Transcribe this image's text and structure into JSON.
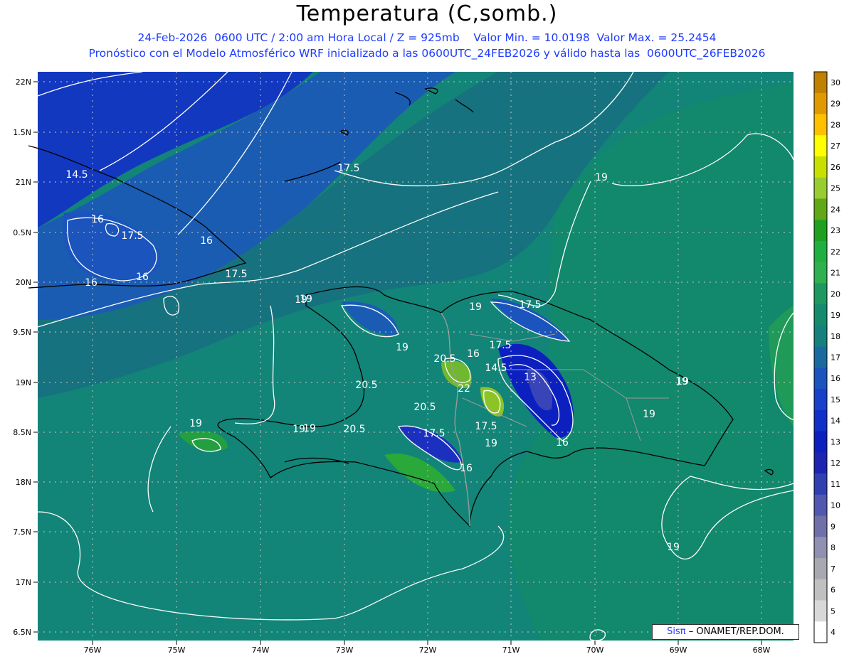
{
  "header": {
    "title": "Temperatura (C,somb.)",
    "subtitle1": "24-Feb-2026  0600 UTC / 2:00 am Hora Local / Z = 925mb    Valor Min. = 10.0198  Valor Max. = 25.2454",
    "subtitle2": "Pronóstico con el Modelo Atmosférico WRF inicializado a las 0600UTC_24FEB2026 y válido hasta las  0600UTC_26FEB2026"
  },
  "map": {
    "lat_labels": [
      "22N",
      "1.5N",
      "21N",
      "0.5N",
      "20N",
      "9.5N",
      "19N",
      "8.5N",
      "18N",
      "7.5N",
      "17N",
      "6.5N"
    ],
    "lon_labels": [
      "76W",
      "75W",
      "74W",
      "73W",
      "72W",
      "71W",
      "70W",
      "69W",
      "68W"
    ],
    "contour_labels": [
      "14.5",
      "16",
      "17.5",
      "16",
      "16",
      "17.5",
      "16",
      "19",
      "17.5",
      "19",
      "19",
      "19",
      "17.5",
      "19",
      "20.5",
      "16",
      "17.5",
      "14.5",
      "13",
      "20.5",
      "22",
      "20.5",
      "19",
      "19",
      "19",
      "19",
      "19",
      "20.5",
      "17.5",
      "17.5",
      "19",
      "16",
      "16",
      "19",
      "19"
    ],
    "colorbar_ticks": [
      "30",
      "29",
      "28",
      "27",
      "26",
      "25",
      "24",
      "23",
      "22",
      "21",
      "20",
      "19",
      "18",
      "17",
      "16",
      "15",
      "14",
      "13",
      "12",
      "11",
      "10",
      "9",
      "8",
      "7",
      "6",
      "5",
      "4"
    ],
    "colorbar_colors": [
      "#c08000",
      "#e09a00",
      "#ffc000",
      "#ffff00",
      "#c8e000",
      "#98cc30",
      "#60a818",
      "#20a020",
      "#20b040",
      "#30b050",
      "#1e9860",
      "#168a6c",
      "#15807c",
      "#1a6aa0",
      "#1a54bc",
      "#1840c8",
      "#1030c8",
      "#0c20c0",
      "#1c24b0",
      "#3040b0",
      "#5058b0",
      "#7070a8",
      "#9090b0",
      "#a8a8b0",
      "#c0c0c0",
      "#d8d8d8",
      "#ffffff"
    ]
  },
  "credit": {
    "brand": "Sisπ",
    "text": "– ONAMET/REP.DOM."
  }
}
